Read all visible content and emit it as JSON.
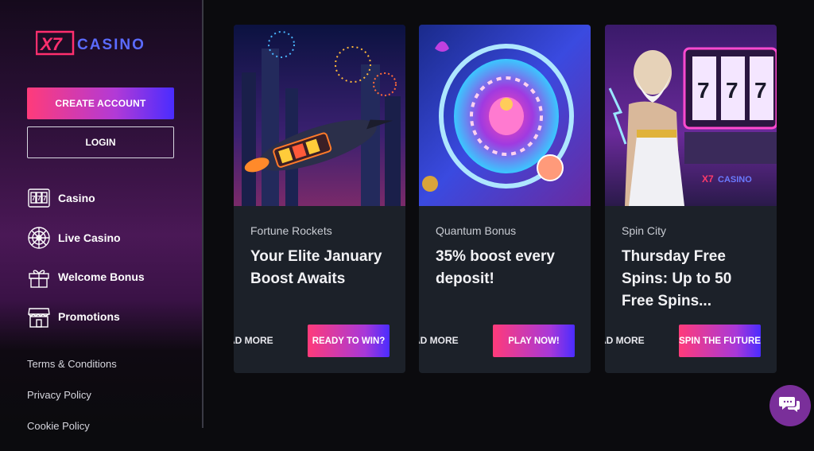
{
  "brand": {
    "logo_text": "X7 CASINO"
  },
  "auth": {
    "create_label": "CREATE ACCOUNT",
    "login_label": "LOGIN"
  },
  "nav": [
    {
      "label": "Casino",
      "icon": "slot-machine-icon"
    },
    {
      "label": "Live Casino",
      "icon": "roulette-icon"
    },
    {
      "label": "Welcome Bonus",
      "icon": "gift-icon"
    },
    {
      "label": "Promotions",
      "icon": "shop-icon"
    }
  ],
  "footer_links": [
    "Terms & Conditions",
    "Privacy Policy",
    "Cookie Policy"
  ],
  "cards": [
    {
      "subtitle": "Fortune Rockets",
      "title": "Your Elite January Boost Awaits",
      "read_more": "AD MORE",
      "cta": "READY TO WIN?"
    },
    {
      "subtitle": "Quantum Bonus",
      "title": "35% boost every deposit!",
      "read_more": "AD MORE",
      "cta": "PLAY NOW!"
    },
    {
      "subtitle": "Spin City",
      "title": "Thursday Free Spins: Up to 50 Free Spins...",
      "read_more": "AD MORE",
      "cta": "SPIN THE FUTURE"
    }
  ],
  "chat": {
    "icon": "chat-icon"
  },
  "colors": {
    "accent_pink": "#ff3b7a",
    "accent_blue": "#4a2cff",
    "card_bg": "#1c2129"
  }
}
